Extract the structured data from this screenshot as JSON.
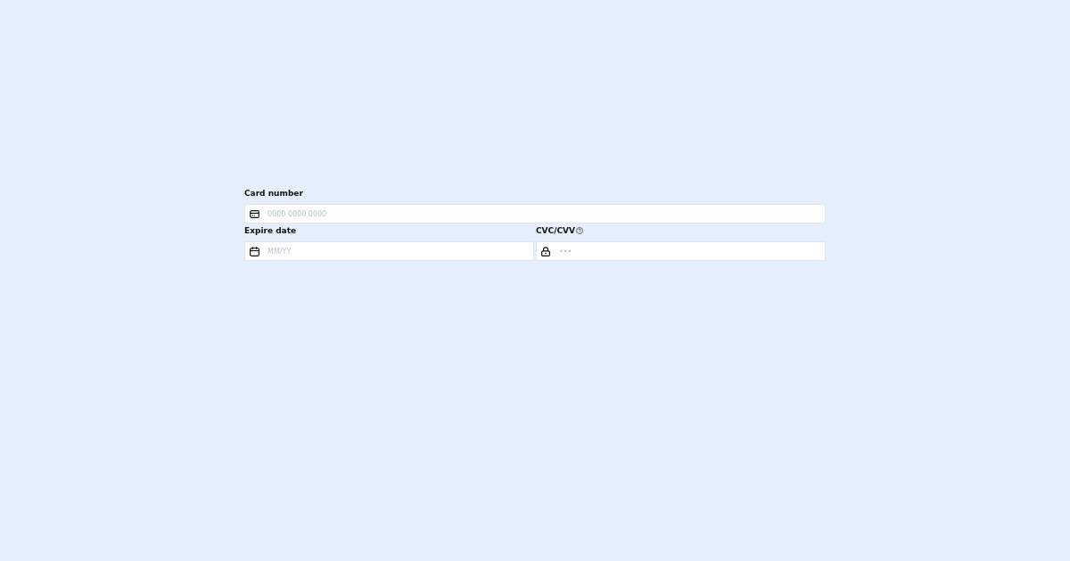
{
  "rows": [
    {
      "fields": [
        {
          "kind": "number",
          "label": "Card number",
          "help_icon": false,
          "placeholder": "0000 0000 0000"
        }
      ]
    },
    {
      "fields": [
        {
          "kind": "date",
          "label": "Expire date",
          "help_icon": false,
          "placeholder": "MM/YY"
        },
        {
          "kind": "code",
          "label": "CVC/CVV",
          "help_icon": true,
          "placeholder": "•••"
        }
      ]
    }
  ]
}
